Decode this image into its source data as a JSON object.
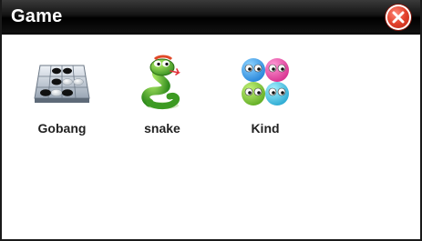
{
  "window": {
    "title": "Game"
  },
  "colors": {
    "titlebar": "#111111",
    "close_button": "#e2412c",
    "background": "#ffffff"
  },
  "apps": [
    {
      "label": "Gobang",
      "icon": "gobang-board-icon"
    },
    {
      "label": "snake",
      "icon": "snake-icon"
    },
    {
      "label": "Kind",
      "icon": "four-faces-icon"
    }
  ]
}
